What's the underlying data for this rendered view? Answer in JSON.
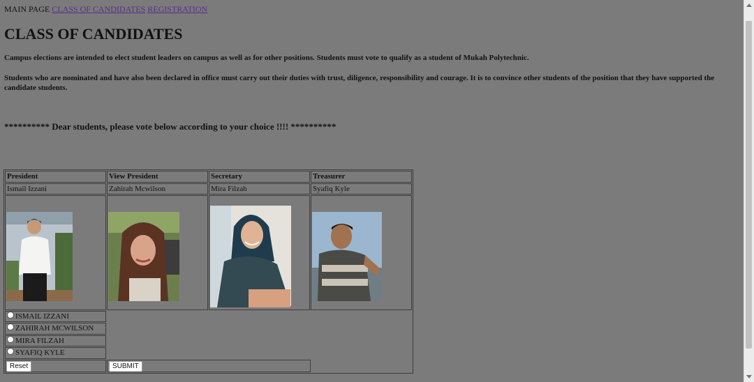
{
  "nav": {
    "main_page": "MAIN PAGE",
    "class_of_candidates": "CLASS OF CANDIDATES",
    "registration": "REGISTRATION"
  },
  "title": "CLASS OF CANDIDATES",
  "intro": {
    "paragraph1": "Campus elections are intended to elect student leaders on campus as well as for other positions. Students must vote to qualify as a student of Mukah Polytechnic.",
    "paragraph2": "Students who are nominated and have also been declared in office must carry out their duties with trust, diligence, responsibility and courage. It is to convince other students of the position that they have supported the candidate students."
  },
  "banner": "********** Dear students, please vote below according to your choice !!!! **********",
  "table": {
    "headers": [
      "President",
      "View President",
      "Secretary",
      "Treasurer"
    ],
    "names": [
      "Ismail Izzani",
      "Zahirah Mcwilson",
      "Mira Filzah",
      "Syafiq Kyle"
    ]
  },
  "vote_options": [
    "ISMAIL IZZANI",
    "ZAHIRAH MCWILSON",
    "MIRA FILZAH",
    "SYAFIQ KYLE"
  ],
  "buttons": {
    "reset": "Reset",
    "submit": "SUBMIT"
  }
}
